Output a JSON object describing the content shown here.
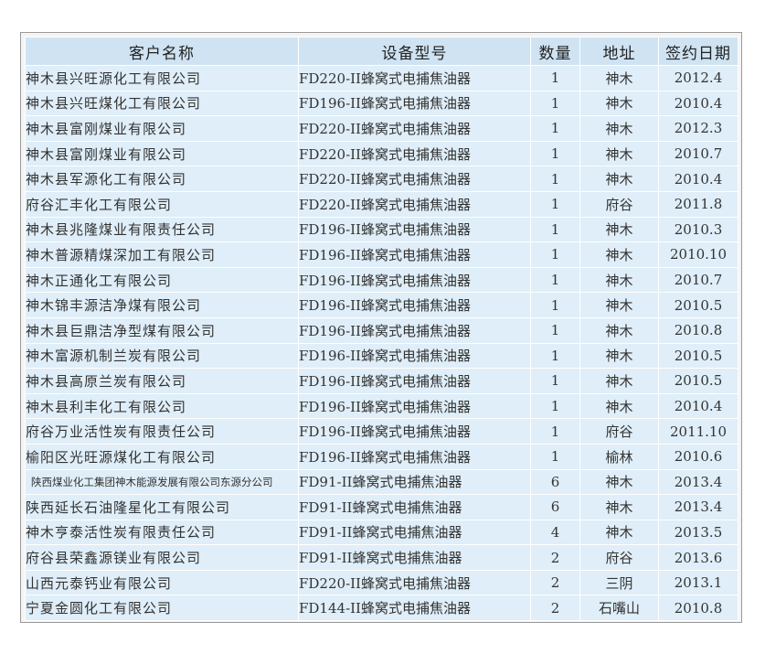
{
  "table": {
    "headers": [
      "客户名称",
      "设备型号",
      "数量",
      "地址",
      "签约日期"
    ],
    "rows": [
      {
        "name": "神木县兴旺源化工有限公司",
        "model": "FD220-II蜂窝式电捕焦油器",
        "qty": "1",
        "addr": "神木",
        "date": "2012.4"
      },
      {
        "name": "神木县兴旺煤化工有限公司",
        "model": "FD196-II蜂窝式电捕焦油器",
        "qty": "1",
        "addr": "神木",
        "date": "2010.4"
      },
      {
        "name": "神木县富刚煤业有限公司",
        "model": "FD220-II蜂窝式电捕焦油器",
        "qty": "1",
        "addr": "神木",
        "date": "2012.3"
      },
      {
        "name": "神木县富刚煤业有限公司",
        "model": "FD220-II蜂窝式电捕焦油器",
        "qty": "1",
        "addr": "神木",
        "date": "2010.7"
      },
      {
        "name": "神木县军源化工有限公司",
        "model": "FD220-II蜂窝式电捕焦油器",
        "qty": "1",
        "addr": "神木",
        "date": "2010.4"
      },
      {
        "name": "府谷汇丰化工有限公司",
        "model": "FD220-II蜂窝式电捕焦油器",
        "qty": "1",
        "addr": "府谷",
        "date": "2011.8"
      },
      {
        "name": "神木县兆隆煤业有限责任公司",
        "model": "FD196-II蜂窝式电捕焦油器",
        "qty": "1",
        "addr": "神木",
        "date": "2010.3"
      },
      {
        "name": "神木普源精煤深加工有限公司",
        "model": "FD196-II蜂窝式电捕焦油器",
        "qty": "1",
        "addr": "神木",
        "date": "2010.10"
      },
      {
        "name": "神木正通化工有限公司",
        "model": "FD196-II蜂窝式电捕焦油器",
        "qty": "1",
        "addr": "神木",
        "date": "2010.7"
      },
      {
        "name": "神木锦丰源洁净煤有限公司",
        "model": "FD196-II蜂窝式电捕焦油器",
        "qty": "1",
        "addr": "神木",
        "date": "2010.5"
      },
      {
        "name": "神木县巨鼎洁净型煤有限公司",
        "model": "FD196-II蜂窝式电捕焦油器",
        "qty": "1",
        "addr": "神木",
        "date": "2010.8"
      },
      {
        "name": "神木富源机制兰炭有限公司",
        "model": "FD196-II蜂窝式电捕焦油器",
        "qty": "1",
        "addr": "神木",
        "date": "2010.5"
      },
      {
        "name": "神木县高原兰炭有限公司",
        "model": "FD196-II蜂窝式电捕焦油器",
        "qty": "1",
        "addr": "神木",
        "date": "2010.5"
      },
      {
        "name": "神木县利丰化工有限公司",
        "model": "FD196-II蜂窝式电捕焦油器",
        "qty": "1",
        "addr": "神木",
        "date": "2010.4"
      },
      {
        "name": "府谷万业活性炭有限责任公司",
        "model": "FD196-II蜂窝式电捕焦油器",
        "qty": "1",
        "addr": "府谷",
        "date": "2011.10"
      },
      {
        "name": "榆阳区光旺源煤化工有限公司",
        "model": "FD196-II蜂窝式电捕焦油器",
        "qty": "1",
        "addr": "榆林",
        "date": "2010.6"
      },
      {
        "name": "陕西煤业化工集团神木能源发展有限公司东源分公司",
        "model": "FD91-II蜂窝式电捕焦油器",
        "qty": "6",
        "addr": "神木",
        "date": "2013.4"
      },
      {
        "name": "陕西延长石油隆星化工有限公司",
        "model": "FD91-II蜂窝式电捕焦油器",
        "qty": "6",
        "addr": "神木",
        "date": "2013.4"
      },
      {
        "name": "神木亨泰活性炭有限责任公司",
        "model": "FD91-II蜂窝式电捕焦油器",
        "qty": "4",
        "addr": "神木",
        "date": "2013.5"
      },
      {
        "name": "府谷县荣鑫源镁业有限公司",
        "model": "FD91-II蜂窝式电捕焦油器",
        "qty": "2",
        "addr": "府谷",
        "date": "2013.6"
      },
      {
        "name": "山西元泰钙业有限公司",
        "model": "FD220-II蜂窝式电捕焦油器",
        "qty": "2",
        "addr": "三阴",
        "date": "2013.1"
      },
      {
        "name": "宁夏金圆化工有限公司",
        "model": "FD144-II蜂窝式电捕焦油器",
        "qty": "2",
        "addr": "石嘴山",
        "date": "2010.8"
      }
    ]
  }
}
